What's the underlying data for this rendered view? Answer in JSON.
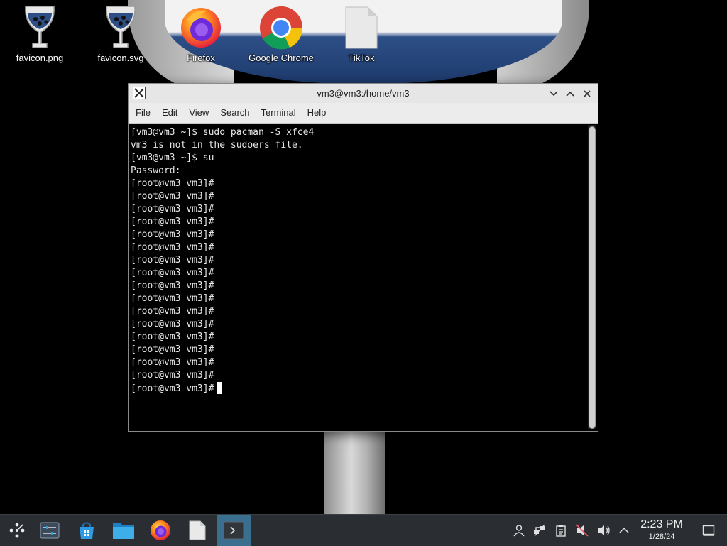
{
  "desktop": {
    "icons": [
      {
        "label": "favicon.png",
        "icon": "wine-glass-icon"
      },
      {
        "label": "favicon.svg",
        "icon": "wine-glass-icon"
      },
      {
        "label": "Firefox",
        "icon": "firefox-icon"
      },
      {
        "label": "Google Chrome",
        "icon": "chrome-icon"
      },
      {
        "label": "TikTok",
        "icon": "file-icon"
      }
    ]
  },
  "terminal": {
    "title": "vm3@vm3:/home/vm3",
    "menu": [
      "File",
      "Edit",
      "View",
      "Search",
      "Terminal",
      "Help"
    ],
    "lines": [
      "[vm3@vm3 ~]$ sudo pacman -S xfce4",
      "vm3 is not in the sudoers file.",
      "[vm3@vm3 ~]$ su",
      "Password:",
      "[root@vm3 vm3]#",
      "[root@vm3 vm3]#",
      "[root@vm3 vm3]#",
      "[root@vm3 vm3]#",
      "[root@vm3 vm3]#",
      "[root@vm3 vm3]#",
      "[root@vm3 vm3]#",
      "[root@vm3 vm3]#",
      "[root@vm3 vm3]#",
      "[root@vm3 vm3]#",
      "[root@vm3 vm3]#",
      "[root@vm3 vm3]#",
      "[root@vm3 vm3]#",
      "[root@vm3 vm3]#",
      "[root@vm3 vm3]#",
      "[root@vm3 vm3]#",
      "[root@vm3 vm3]#"
    ],
    "prompt": "[root@vm3 vm3]#"
  },
  "taskbar": {
    "items": [
      "app-launcher-icon",
      "settings-sliders-icon",
      "store-bag-icon",
      "folder-icon",
      "firefox-icon",
      "file-icon",
      "terminal-icon"
    ],
    "tray": [
      "user-icon",
      "network-icon",
      "clipboard-icon",
      "mute-icon",
      "volume-icon",
      "chevron-up-icon"
    ],
    "time": "2:23 PM",
    "date": "1/28/24",
    "show_desktop": "show-desktop-icon"
  },
  "colors": {
    "taskbar_bg": "#2a2e32",
    "taskbar_active": "#3b6f8f",
    "terminal_bg": "#000000",
    "terminal_fg": "#e6e6e6"
  }
}
